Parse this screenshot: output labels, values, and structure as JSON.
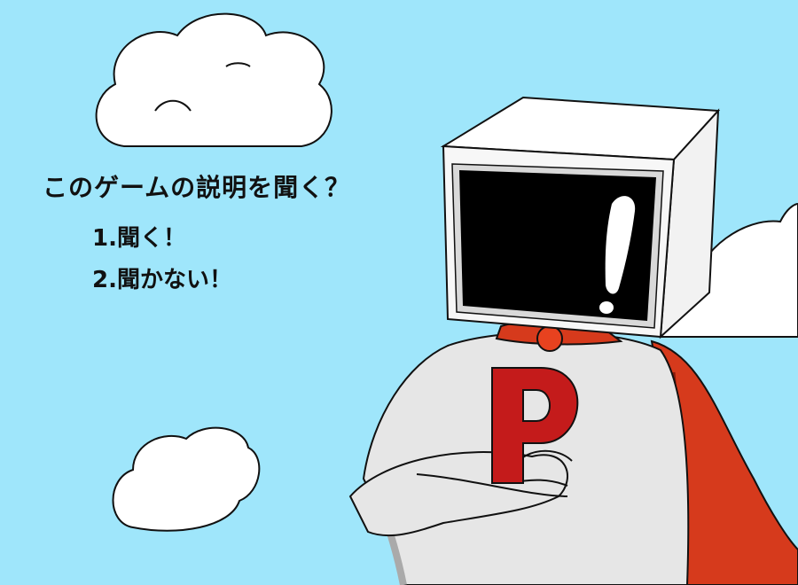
{
  "dialog": {
    "question": "このゲームの説明を聞く？",
    "options": [
      {
        "label": "1.聞く！"
      },
      {
        "label": "2.聞かない！"
      }
    ]
  },
  "character": {
    "chest_letter": "P",
    "screen_symbol": "!"
  },
  "colors": {
    "sky": "#9fe6fb",
    "cloud": "#ffffff",
    "cape": "#d63a1c",
    "emblem": "#c41b1b",
    "suit": "#e6e6e6"
  },
  "icons": [
    "cloud",
    "monitor-head",
    "exclamation-mark",
    "cape",
    "p-emblem"
  ]
}
